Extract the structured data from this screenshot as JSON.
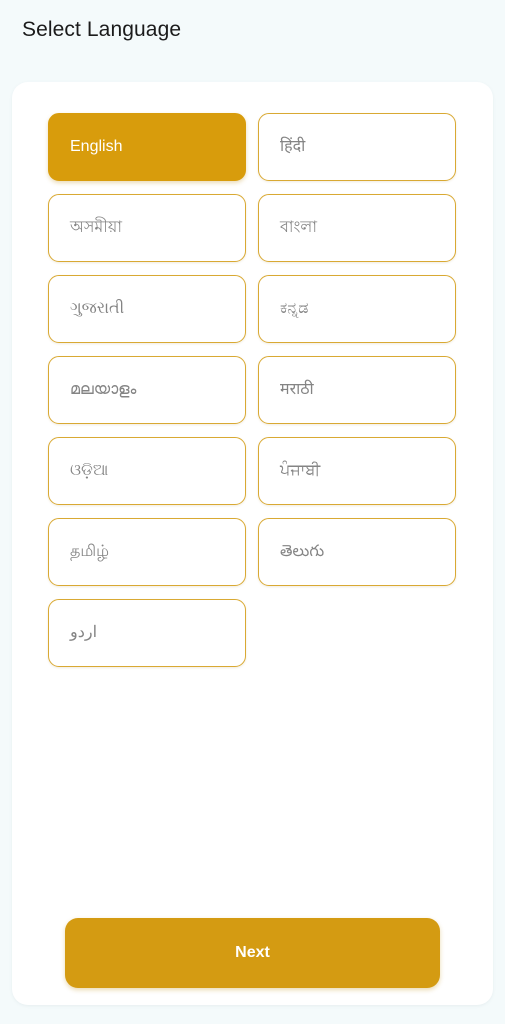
{
  "screen": {
    "title": "Select Language",
    "background_color": "#f4fafb",
    "card_background": "#ffffff"
  },
  "theme": {
    "accent_color": "#d89c0c",
    "accent_border_color": "#d9a933",
    "unselected_text_color": "#848484",
    "selected_text_color": "#ffffff",
    "title_color": "#1b1b1b"
  },
  "languages": [
    {
      "label": "English",
      "selected": true
    },
    {
      "label": "हिंदी",
      "selected": false
    },
    {
      "label": "অসমীয়া",
      "selected": false
    },
    {
      "label": "বাংলা",
      "selected": false
    },
    {
      "label": "ગુજરાતી",
      "selected": false
    },
    {
      "label": "ಕನ್ನಡ",
      "selected": false
    },
    {
      "label": "മലയാളം",
      "selected": false
    },
    {
      "label": "मराठी",
      "selected": false
    },
    {
      "label": "ଓଡ଼ିଆ",
      "selected": false
    },
    {
      "label": "ਪੰਜਾਬੀ",
      "selected": false
    },
    {
      "label": "தமிழ்",
      "selected": false
    },
    {
      "label": "తెలుగు",
      "selected": false
    },
    {
      "label": "اردو",
      "selected": false
    }
  ],
  "footer": {
    "next_label": "Next"
  }
}
